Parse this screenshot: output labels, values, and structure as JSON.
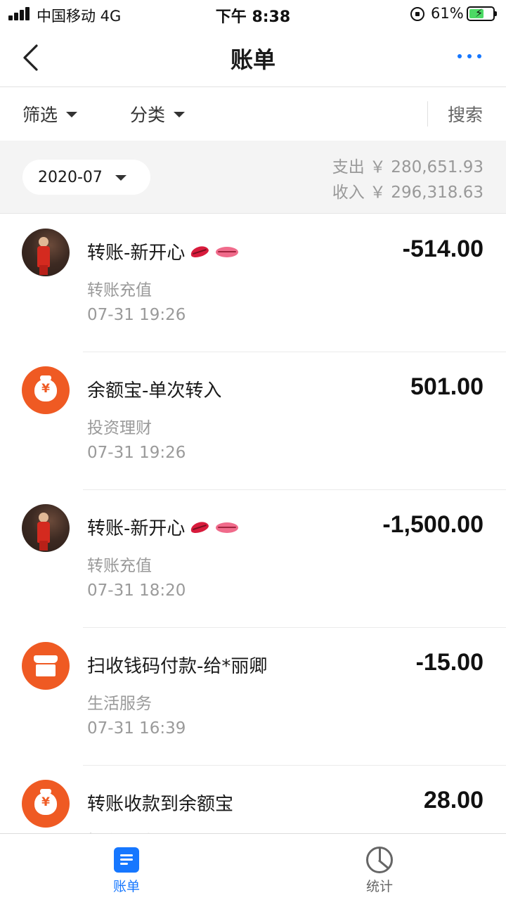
{
  "status_bar": {
    "carrier": "中国移动  4G",
    "time": "下午 8:38",
    "battery_percent": "61%",
    "battery_level": 0.61
  },
  "nav": {
    "title": "账单",
    "back_icon": "chevron-left-icon",
    "more_icon": "more-dots-icon",
    "accent_color": "#1677ff"
  },
  "filters": {
    "filter_label": "筛选",
    "category_label": "分类",
    "search_label": "搜索"
  },
  "month_header": {
    "month": "2020-07",
    "expense": "支出 ￥ 280,651.93",
    "income": "收入 ￥ 296,318.63"
  },
  "transactions": [
    {
      "avatar": "profile-photo",
      "title": "转账-新开心",
      "emojis": [
        "kiss-mark",
        "mouth"
      ],
      "category": "转账充值",
      "time": "07-31  19:26",
      "amount": "-514.00"
    },
    {
      "avatar": "money-bag-icon",
      "title": "余额宝-单次转入",
      "category": "投资理财",
      "time": "07-31  19:26",
      "amount": "501.00"
    },
    {
      "avatar": "profile-photo",
      "title": "转账-新开心",
      "emojis": [
        "kiss-mark",
        "mouth"
      ],
      "category": "转账充值",
      "time": "07-31  18:20",
      "amount": "-1,500.00"
    },
    {
      "avatar": "shop-icon",
      "title": "扫收钱码付款-给*丽卿",
      "category": "生活服务",
      "time": "07-31  16:39",
      "amount": "-15.00"
    },
    {
      "avatar": "money-bag-icon",
      "title": "转账收款到余额宝",
      "category": "投资理财",
      "time": "",
      "amount": "28.00"
    }
  ],
  "tab_bar": {
    "bill_label": "账单",
    "stats_label": "统计",
    "active_color": "#1677ff",
    "inactive_color": "#666666"
  }
}
